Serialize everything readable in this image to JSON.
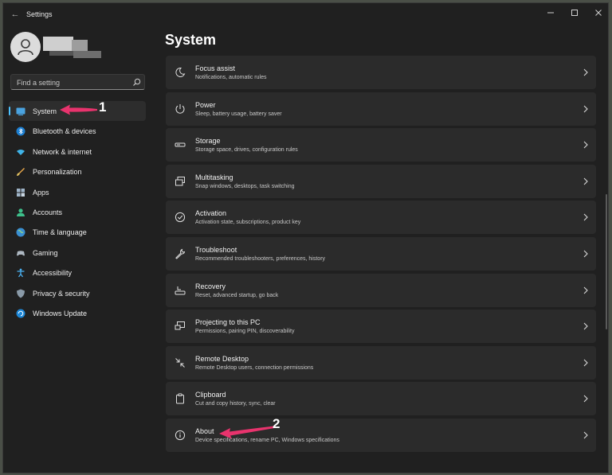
{
  "window": {
    "title": "Settings"
  },
  "user": {
    "name": "",
    "email": ""
  },
  "search": {
    "placeholder": "Find a setting"
  },
  "sidebar": {
    "items": [
      {
        "label": "System",
        "active": true
      },
      {
        "label": "Bluetooth & devices"
      },
      {
        "label": "Network & internet"
      },
      {
        "label": "Personalization"
      },
      {
        "label": "Apps"
      },
      {
        "label": "Accounts"
      },
      {
        "label": "Time & language"
      },
      {
        "label": "Gaming"
      },
      {
        "label": "Accessibility"
      },
      {
        "label": "Privacy & security"
      },
      {
        "label": "Windows Update"
      }
    ]
  },
  "page": {
    "title": "System"
  },
  "settings": [
    {
      "title": "Focus assist",
      "subtitle": "Notifications, automatic rules",
      "icon": "moon-icon"
    },
    {
      "title": "Power",
      "subtitle": "Sleep, battery usage, battery saver",
      "icon": "power-icon"
    },
    {
      "title": "Storage",
      "subtitle": "Storage space, drives, configuration rules",
      "icon": "storage-icon"
    },
    {
      "title": "Multitasking",
      "subtitle": "Snap windows, desktops, task switching",
      "icon": "multitasking-icon"
    },
    {
      "title": "Activation",
      "subtitle": "Activation state, subscriptions, product key",
      "icon": "check-circle-icon"
    },
    {
      "title": "Troubleshoot",
      "subtitle": "Recommended troubleshooters, preferences, history",
      "icon": "wrench-icon"
    },
    {
      "title": "Recovery",
      "subtitle": "Reset, advanced startup, go back",
      "icon": "recovery-icon"
    },
    {
      "title": "Projecting to this PC",
      "subtitle": "Permissions, pairing PIN, discoverability",
      "icon": "projecting-icon"
    },
    {
      "title": "Remote Desktop",
      "subtitle": "Remote Desktop users, connection permissions",
      "icon": "remote-desktop-icon"
    },
    {
      "title": "Clipboard",
      "subtitle": "Cut and copy history, sync, clear",
      "icon": "clipboard-icon"
    },
    {
      "title": "About",
      "subtitle": "Device specifications, rename PC, Windows specifications",
      "icon": "info-icon"
    }
  ],
  "annotations": {
    "one": "1",
    "two": "2"
  },
  "colors": {
    "accent": "#4cc2ff",
    "annotation": "#e8336d",
    "background": "#202020",
    "card": "#2b2b2b"
  }
}
